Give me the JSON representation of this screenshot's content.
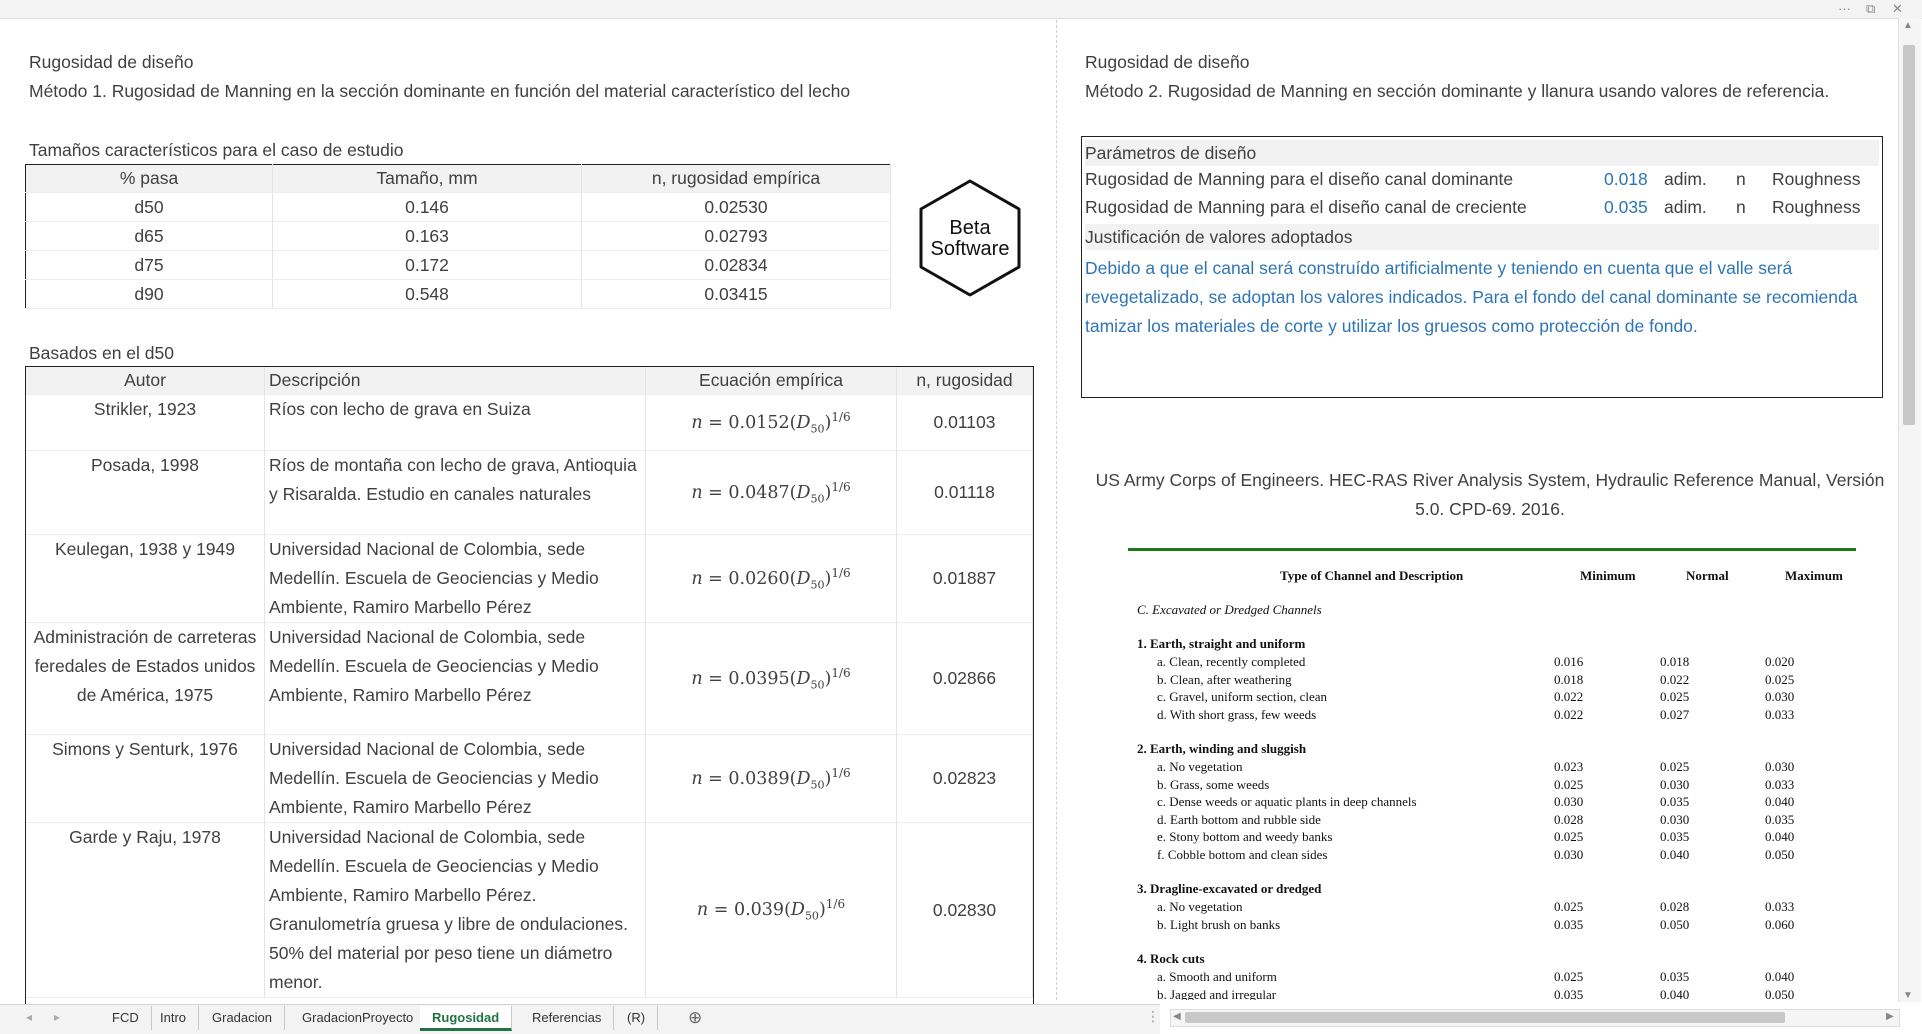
{
  "window": {
    "more_glyph": "···",
    "restore_glyph": "⧉",
    "close_glyph": "✕"
  },
  "left": {
    "title": "Rugosidad de diseño",
    "method": "Método 1. Rugosidad de Manning en la sección dominante en función del material característico del lecho",
    "sizes_caption": "Tamaños característicos para el caso de estudio",
    "sizes_table": {
      "headers": [
        "% pasa",
        "Tamaño, mm",
        "n, rugosidad empírica"
      ],
      "rows": [
        [
          "d50",
          "0.146",
          "0.02530"
        ],
        [
          "d65",
          "0.163",
          "0.02793"
        ],
        [
          "d75",
          "0.172",
          "0.02834"
        ],
        [
          "d90",
          "0.548",
          "0.03415"
        ]
      ]
    },
    "logo": {
      "line1": "Beta",
      "line2": "Software"
    },
    "d50_caption": "Basados en el d50",
    "d50_table": {
      "headers": [
        "Autor",
        "Descripción",
        "Ecuación empírica",
        "n, rugosidad"
      ],
      "rows": [
        {
          "autor": "Strikler, 1923",
          "desc": "Ríos con lecho de grava en Suiza",
          "coef": "0.0152",
          "n": "0.01103"
        },
        {
          "autor": "Posada, 1998",
          "desc": "Ríos de montaña con lecho de grava, Antioquia y Risaralda. Estudio en canales naturales",
          "coef": "0.0487",
          "n": "0.01118"
        },
        {
          "autor": "Keulegan, 1938 y 1949",
          "desc": "Universidad Nacional de Colombia, sede Medellín. Escuela de Geociencias y Medio Ambiente, Ramiro Marbello Pérez",
          "coef": "0.0260",
          "n": "0.01887"
        },
        {
          "autor": "Administración de carreteras feredales de Estados unidos de América, 1975",
          "desc": "Universidad Nacional de Colombia, sede Medellín. Escuela de Geociencias y Medio Ambiente, Ramiro Marbello Pérez",
          "coef": "0.0395",
          "n": "0.02866"
        },
        {
          "autor": "Simons y Senturk, 1976",
          "desc": "Universidad Nacional de Colombia, sede Medellín. Escuela de Geociencias y Medio Ambiente, Ramiro Marbello Pérez",
          "coef": "0.0389",
          "n": "0.02823"
        },
        {
          "autor": "Garde y Raju, 1978",
          "desc": "Universidad Nacional de Colombia, sede Medellín. Escuela de Geociencias y Medio Ambiente, Ramiro Marbello Pérez. Granulometría gruesa y libre de ondulaciones. 50% del material por peso tiene un diámetro menor.",
          "coef": "0.039",
          "n": "0.02830"
        }
      ],
      "eq_prefix": "n = ",
      "eq_var": "D",
      "eq_sub": "50",
      "eq_exp": "1/6"
    }
  },
  "right": {
    "title": "Rugosidad de diseño",
    "method": "Método 2.  Rugosidad de Manning en sección dominante y llanura usando valores de referencia.",
    "params_header": "Parámetros de diseño",
    "params": [
      {
        "label": "Rugosidad de Manning para el diseño canal dominante",
        "value": "0.018",
        "unit": "adim.",
        "sym": "n",
        "tag": "Roughness"
      },
      {
        "label": "Rugosidad de Manning para el diseño canal de creciente",
        "value": "0.035",
        "unit": "adim.",
        "sym": "n",
        "tag": "Roughness"
      }
    ],
    "justif_header": "Justificación de valores adoptados",
    "justif_lines": [
      "Debido a que el canal será construído artificialmente y teniendo en cuenta que el valle será",
      "revegetalizado, se adoptan los valores indicados. Para el fondo del canal dominante se recomienda",
      "tamizar los materiales de corte y utilizar los gruesos como protección de fondo."
    ],
    "reference_line1": "US Army Corps of Engineers. HEC-RAS River Analysis System, Hydraulic Reference Manual, Versión",
    "reference_line2": "5.0. CPD-69. 2016.",
    "ref_table": {
      "headers": [
        "Type of Channel and Description",
        "Minimum",
        "Normal",
        "Maximum"
      ],
      "section": "C.  Excavated or Dredged Channels",
      "groups": [
        {
          "title": "1.  Earth, straight and uniform",
          "items": [
            [
              "a.  Clean, recently completed",
              "0.016",
              "0.018",
              "0.020"
            ],
            [
              "b.  Clean, after weathering",
              "0.018",
              "0.022",
              "0.025"
            ],
            [
              "c.  Gravel, uniform section, clean",
              "0.022",
              "0.025",
              "0.030"
            ],
            [
              "d.  With short grass, few weeds",
              "0.022",
              "0.027",
              "0.033"
            ]
          ]
        },
        {
          "title": "2.  Earth, winding and sluggish",
          "items": [
            [
              "a.    No vegetation",
              "0.023",
              "0.025",
              "0.030"
            ],
            [
              "b.    Grass, some weeds",
              "0.025",
              "0.030",
              "0.033"
            ],
            [
              "c.    Dense weeds or aquatic plants in deep channels",
              "0.030",
              "0.035",
              "0.040"
            ],
            [
              "d.    Earth bottom and rubble side",
              "0.028",
              "0.030",
              "0.035"
            ],
            [
              "e.    Stony bottom and weedy banks",
              "0.025",
              "0.035",
              "0.040"
            ],
            [
              "f.    Cobble bottom and clean sides",
              "0.030",
              "0.040",
              "0.050"
            ]
          ]
        },
        {
          "title": "3.  Dragline-excavated or dredged",
          "items": [
            [
              "a.    No vegetation",
              "0.025",
              "0.028",
              "0.033"
            ],
            [
              "b.    Light brush on banks",
              "0.035",
              "0.050",
              "0.060"
            ]
          ]
        },
        {
          "title": "4.  Rock cuts",
          "items": [
            [
              "a.    Smooth and uniform",
              "0.025",
              "0.035",
              "0.040"
            ],
            [
              "b.    Jagged and irregular",
              "0.035",
              "0.040",
              "0.050"
            ]
          ]
        }
      ]
    }
  },
  "tabs": [
    "FCD",
    "Intro",
    "Gradacion",
    "GradacionProyecto",
    "Rugosidad",
    "Referencias",
    "(R)"
  ],
  "active_tab": "Rugosidad",
  "add_sheet": "⊕",
  "colors": {
    "accent_green": "#217346",
    "link_blue": "#2e75b6",
    "ref_rule_green": "#1b7a1b"
  }
}
